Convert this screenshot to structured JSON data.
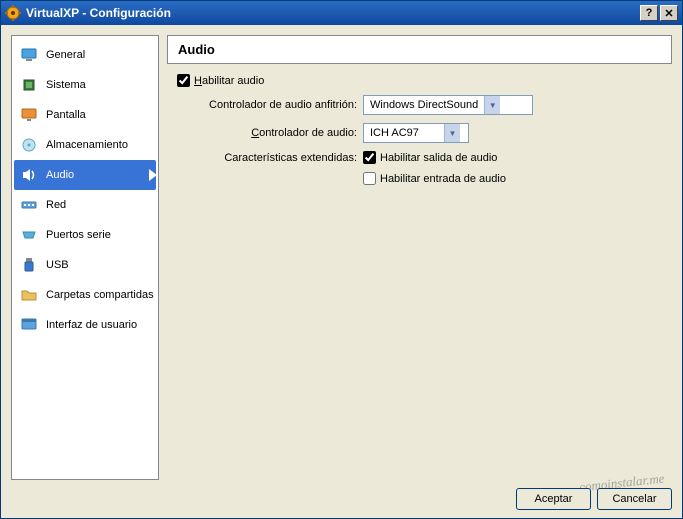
{
  "window": {
    "title": "VirtualXP - Configuración"
  },
  "sidebar": {
    "items": [
      {
        "label": "General"
      },
      {
        "label": "Sistema"
      },
      {
        "label": "Pantalla"
      },
      {
        "label": "Almacenamiento"
      },
      {
        "label": "Audio"
      },
      {
        "label": "Red"
      },
      {
        "label": "Puertos serie"
      },
      {
        "label": "USB"
      },
      {
        "label": "Carpetas compartidas"
      },
      {
        "label": "Interfaz de usuario"
      }
    ]
  },
  "page": {
    "title": "Audio",
    "enable_audio_label": "Habilitar audio",
    "host_driver_label": "Controlador de audio anfitrión:",
    "host_driver_value": "Windows DirectSound",
    "controller_label": "Controlador de audio:",
    "controller_value": "ICH AC97",
    "extended_label": "Características extendidas:",
    "enable_output_label": "Habilitar salida de audio",
    "enable_input_label": "Habilitar entrada de audio"
  },
  "buttons": {
    "ok": "Aceptar",
    "cancel": "Cancelar"
  },
  "watermark": "comoinstalar.me"
}
